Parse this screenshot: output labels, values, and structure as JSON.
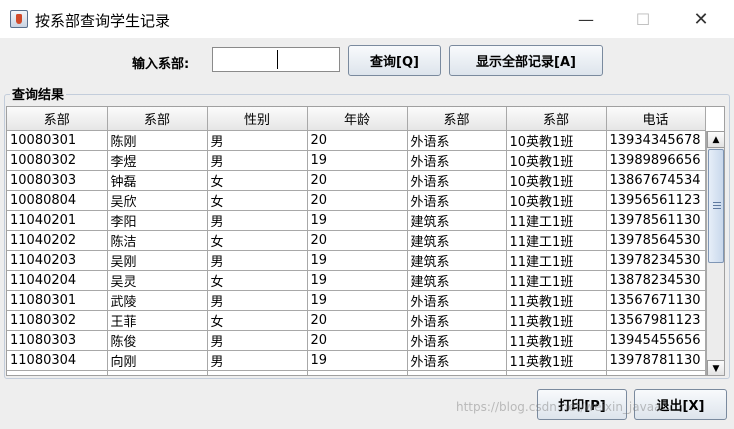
{
  "window": {
    "title": "按系部查询学生记录",
    "minimize": "—",
    "maximize": "☐",
    "close": "✕"
  },
  "query": {
    "label": "输入系部:",
    "value": "",
    "query_button": "查询[Q]",
    "show_all_button": "显示全部记录[A]"
  },
  "results": {
    "group_label": "查询结果",
    "columns": [
      "系部",
      "系部",
      "性别",
      "年龄",
      "系部",
      "系部",
      "电话"
    ],
    "rows": [
      [
        "10080301",
        "陈刚",
        "男",
        "20",
        "外语系",
        "10英教1班",
        "13934345678"
      ],
      [
        "10080302",
        "李煜",
        "男",
        "19",
        "外语系",
        "10英教1班",
        "13989896656"
      ],
      [
        "10080303",
        "钟磊",
        "女",
        "20",
        "外语系",
        "10英教1班",
        "13867674534"
      ],
      [
        "10080804",
        "吴欣",
        "女",
        "20",
        "外语系",
        "10英教1班",
        "13956561123"
      ],
      [
        "11040201",
        "李阳",
        "男",
        "19",
        "建筑系",
        "11建工1班",
        "13978561130"
      ],
      [
        "11040202",
        "陈洁",
        "女",
        "20",
        "建筑系",
        "11建工1班",
        "13978564530"
      ],
      [
        "11040203",
        "吴刚",
        "男",
        "19",
        "建筑系",
        "11建工1班",
        "13978234530"
      ],
      [
        "11040204",
        "吴灵",
        "女",
        "19",
        "建筑系",
        "11建工1班",
        "13878234530"
      ],
      [
        "11080301",
        "武陵",
        "男",
        "19",
        "外语系",
        "11英教1班",
        "13567671130"
      ],
      [
        "11080302",
        "王菲",
        "女",
        "20",
        "外语系",
        "11英教1班",
        "13567981123"
      ],
      [
        "11080303",
        "陈俊",
        "男",
        "20",
        "外语系",
        "11英教1班",
        "13945455656"
      ],
      [
        "11080304",
        "向刚",
        "男",
        "19",
        "外语系",
        "11英教1班",
        "13978781130"
      ],
      [
        "",
        "",
        "",
        "",
        "",
        "",
        ""
      ]
    ]
  },
  "scrollbar": {
    "up_icon": "arrow-up-icon",
    "down_icon": "arrow-down-icon"
  },
  "footer": {
    "print_button": "打印[P]",
    "exit_button": "退出[X]"
  },
  "watermark": "https://blog.csdn.net/weixin_javaa"
}
